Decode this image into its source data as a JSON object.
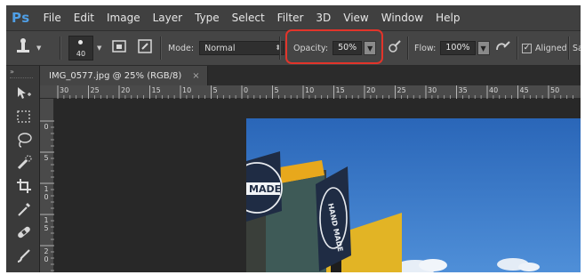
{
  "app": {
    "logo": "Ps"
  },
  "menu": [
    "File",
    "Edit",
    "Image",
    "Layer",
    "Type",
    "Select",
    "Filter",
    "3D",
    "View",
    "Window",
    "Help"
  ],
  "options": {
    "brush_size": "40",
    "mode_label": "Mode:",
    "mode_value": "Normal",
    "opacity_label": "Opacity:",
    "opacity_value": "50%",
    "flow_label": "Flow:",
    "flow_value": "100%",
    "aligned_label": "Aligned",
    "aligned_checked": true,
    "sample_label_partial": "Sa"
  },
  "document": {
    "tab_label": "IMG_0577.jpg @ 25% (RGB/8)",
    "close_glyph": "×"
  },
  "rulers": {
    "horizontal_labels": [
      "30",
      "25",
      "20",
      "15",
      "10",
      "5",
      "0",
      "5",
      "10",
      "15",
      "20",
      "25",
      "30",
      "35",
      "40",
      "45",
      "50"
    ],
    "vertical_labels": [
      "0",
      "5",
      "10",
      "15",
      "20"
    ]
  },
  "tools": [
    "move-icon",
    "marquee-icon",
    "lasso-icon",
    "quick-selection-icon",
    "crop-icon",
    "eyedropper-icon",
    "healing-brush-icon",
    "brush-icon"
  ],
  "photo": {
    "sign_text_1": "MADE",
    "sign_text_2": "HAND MADE"
  },
  "colors": {
    "highlight": "#e2342a",
    "ps_blue": "#4f9fe6",
    "sky": "#2f73c8"
  }
}
